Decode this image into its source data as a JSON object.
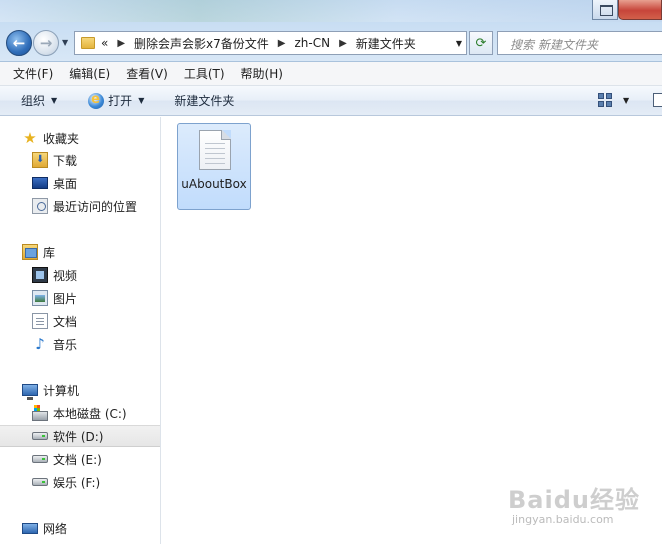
{
  "window": {
    "close_color": "#c7453a"
  },
  "address": {
    "overflow": "«",
    "crumbs": [
      "删除会声会影x7备份文件",
      "zh-CN",
      "新建文件夹"
    ]
  },
  "search": {
    "placeholder": "搜索 新建文件夹"
  },
  "menubar": {
    "items": [
      "文件(F)",
      "编辑(E)",
      "查看(V)",
      "工具(T)",
      "帮助(H)"
    ]
  },
  "toolbar": {
    "organize": "组织",
    "open": "打开",
    "new_folder": "新建文件夹"
  },
  "navigation": {
    "favorites": {
      "label": "收藏夹",
      "items": [
        "下载",
        "桌面",
        "最近访问的位置"
      ]
    },
    "libraries": {
      "label": "库",
      "items": [
        "视频",
        "图片",
        "文档",
        "音乐"
      ]
    },
    "computer": {
      "label": "计算机",
      "items": [
        "本地磁盘 (C:)",
        "软件 (D:)",
        "文档 (E:)",
        "娱乐 (F:)"
      ],
      "selected": "软件 (D:)"
    },
    "network": {
      "label": "网络"
    }
  },
  "files": [
    {
      "name": "uAboutBox",
      "icon": "text-file-icon",
      "selected": true
    }
  ],
  "watermark": {
    "logo": "Baidu经验",
    "url": "jingyan.baidu.com"
  },
  "colors": {
    "selection_fill": "#c1dcfc",
    "selection_border": "#7da2ce",
    "accent": "#2f6db9"
  }
}
